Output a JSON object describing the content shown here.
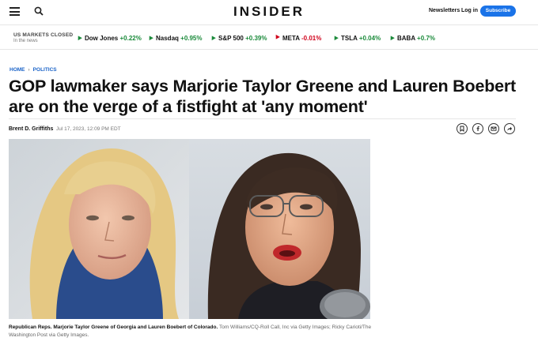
{
  "header": {
    "logo": "INSIDER",
    "newsletters_label": "Newsletters",
    "login_label": "Log in",
    "subscribe_label": "Subscribe",
    "menu_icon": "hamburger-menu-icon",
    "search_icon": "search-icon"
  },
  "markets": {
    "title": "US MARKETS CLOSED",
    "subtitle": "In the news",
    "tickers": [
      {
        "name": "Dow Jones",
        "change": "+0.22%",
        "direction": "up"
      },
      {
        "name": "Nasdaq",
        "change": "+0.95%",
        "direction": "up"
      },
      {
        "name": "S&P 500",
        "change": "+0.39%",
        "direction": "up"
      },
      {
        "name": "META",
        "change": "-0.01%",
        "direction": "down"
      },
      {
        "name": "TSLA",
        "change": "+0.04%",
        "direction": "up"
      },
      {
        "name": "BABA",
        "change": "+0.7%",
        "direction": "up"
      }
    ]
  },
  "breadcrumb": {
    "home": "HOME",
    "section": "POLITICS"
  },
  "article": {
    "headline": "GOP lawmaker says Marjorie Taylor Greene and Lauren Boebert are on the verge of a fistfight at 'any moment'",
    "author": "Brent D. Griffiths",
    "date": "Jul 17, 2023, 12:09 PM EDT",
    "share_icons": [
      "bookmark-icon",
      "facebook-icon",
      "email-icon",
      "share-icon"
    ],
    "caption": "Republican Reps. Marjorie Taylor Greene of Georgia and Lauren Boebert of Colorado.",
    "credit": "Tom Williams/CQ-Roll Call, Inc via Getty Images; Ricky Carioti/The Washington Post via Getty Images."
  },
  "colors": {
    "accent": "#1a73e8",
    "link": "#1a63c8",
    "up": "#1a8a3a",
    "down": "#d0021b"
  }
}
